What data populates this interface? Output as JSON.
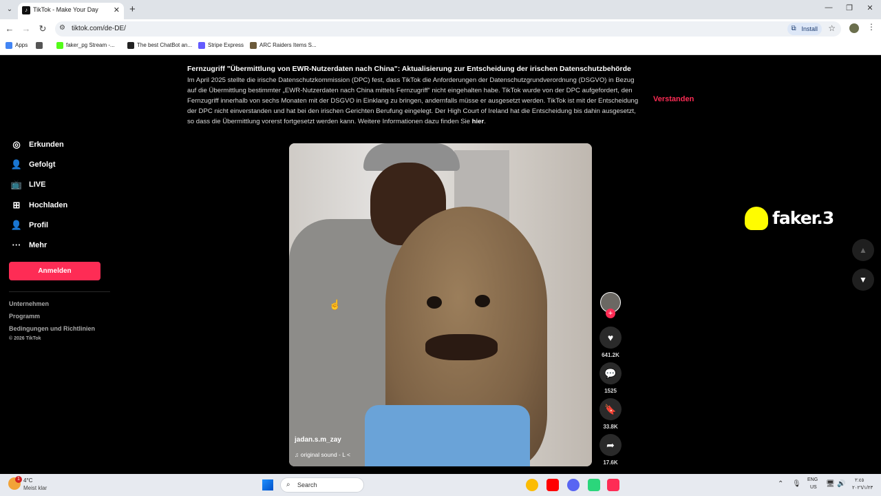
{
  "browser": {
    "tab_title": "TikTok - Make Your Day",
    "url": "tiktok.com/de-DE/",
    "install_label": "Install",
    "bookmarks": [
      {
        "label": "Apps"
      },
      {
        "label": "faker_pg Stream -..."
      },
      {
        "label": "The best ChatBot an..."
      },
      {
        "label": "Stripe Express"
      },
      {
        "label": "ARC Raiders Items S..."
      }
    ]
  },
  "sidebar": {
    "items": [
      {
        "label": "Erkunden",
        "icon": "compass-icon"
      },
      {
        "label": "Gefolgt",
        "icon": "following-icon"
      },
      {
        "label": "LIVE",
        "icon": "live-tv-icon"
      },
      {
        "label": "Hochladen",
        "icon": "upload-icon"
      },
      {
        "label": "Profil",
        "icon": "profile-icon"
      },
      {
        "label": "Mehr",
        "icon": "more-icon"
      }
    ],
    "login_label": "Anmelden",
    "footer": [
      "Unternehmen",
      "Programm",
      "Bedingungen und Richtlinien"
    ],
    "copyright": "© 2026 TikTok"
  },
  "notice": {
    "title": "Fernzugriff \"Übermittlung von EWR-Nutzerdaten nach China\": Aktualisierung zur Entscheidung der irischen Datenschutzbehörde",
    "body": "Im April 2025 stellte die irische Datenschutzkommission (DPC) fest, dass TikTok die Anforderungen der Datenschutzgrundverordnung (DSGVO) in Bezug auf die Übermittlung bestimmter „EWR-Nutzerdaten nach China mittels Fernzugriff“ nicht eingehalten habe. TikTok wurde von der DPC aufgefordert, den Fernzugriff innerhalb von sechs Monaten mit der DSGVO in Einklang zu bringen, andernfalls müsse er ausgesetzt werden. TikTok ist mit der Entscheidung der DPC nicht einverstanden und hat bei den irischen Gerichten Berufung eingelegt. Der High Court of Ireland hat die Entscheidung bis dahin ausgesetzt, so dass die Übermittlung vorerst fortgesetzt werden kann. Weitere Informationen dazu finden Sie ",
    "link_label": "hier",
    "end": ".",
    "dismiss_label": "Verstanden"
  },
  "video": {
    "author": "jadan.s.m_zay",
    "sound": "original sound - L <"
  },
  "actions": {
    "likes": "641.2K",
    "comments": "1525",
    "saves": "33.8K",
    "shares": "17.6K"
  },
  "overlay": {
    "watermark_text": "faker.3"
  },
  "taskbar": {
    "weather_badge": "1",
    "temperature": "4°C",
    "weather_desc": "Meist klar",
    "search_placeholder": "Search",
    "lang_top": "ENG",
    "lang_bottom": "US",
    "clock_top": "٢:٤٥",
    "clock_bottom": "٢٠٢٦/١/٢٣"
  }
}
